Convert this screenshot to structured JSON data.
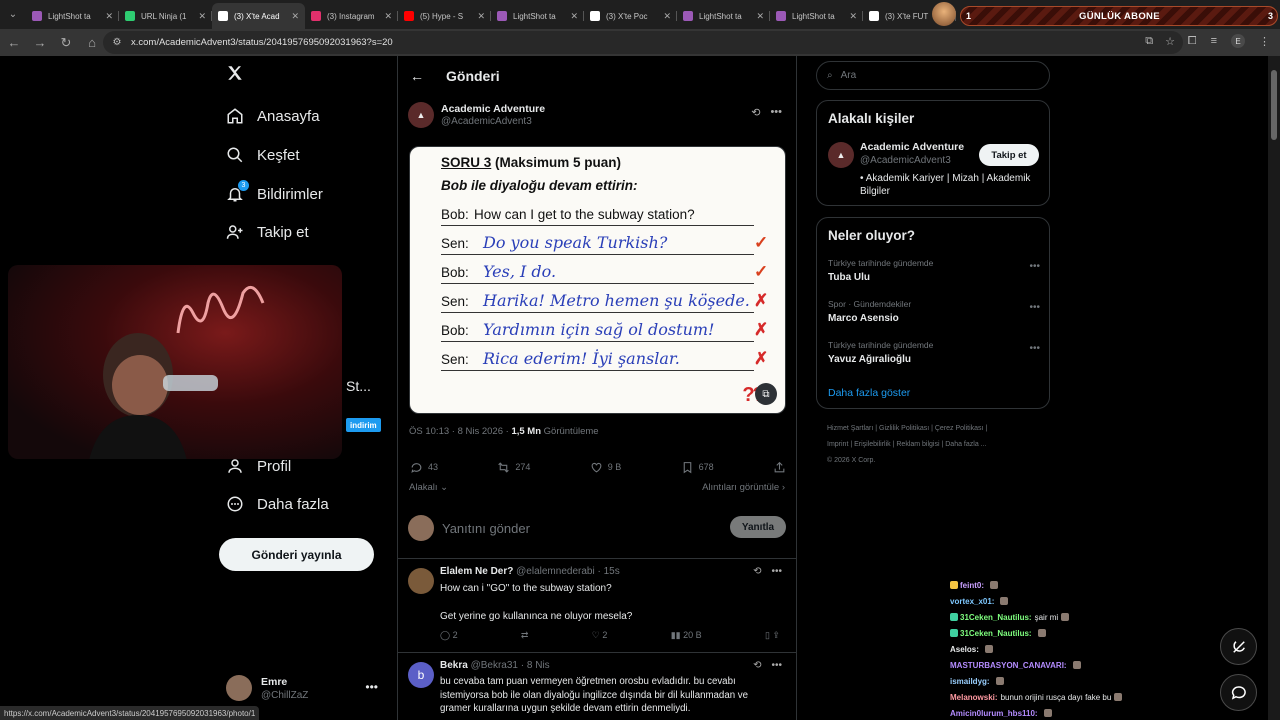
{
  "browser": {
    "tabs": [
      {
        "title": "LightShot ta",
        "color": "#9b59b6",
        "active": false
      },
      {
        "title": "URL Ninja (1",
        "color": "#2ecc71",
        "active": false
      },
      {
        "title": "(3) X'te Acad",
        "color": "#ffffff",
        "active": true
      },
      {
        "title": "(3) Instagram",
        "color": "#e1306c",
        "active": false
      },
      {
        "title": "(5) Hype - S",
        "color": "#ff0000",
        "active": false
      },
      {
        "title": "LightShot ta",
        "color": "#9b59b6",
        "active": false
      },
      {
        "title": "(3) X'te Poc",
        "color": "#ffffff",
        "active": false
      },
      {
        "title": "LightShot ta",
        "color": "#9b59b6",
        "active": false
      },
      {
        "title": "LightShot ta",
        "color": "#9b59b6",
        "active": false
      },
      {
        "title": "(3) X'te FUT",
        "color": "#ffffff",
        "active": false
      }
    ],
    "url": "x.com/AcademicAdvent3/status/2041957695092031963?s=20",
    "profile_initial": "E",
    "status_url": "https://x.com/AcademicAdvent3/status/2041957695092031963/photo/1"
  },
  "stream": {
    "banner_text": "GÜNLÜK ABONE",
    "level_left": "1",
    "level_right": "3",
    "side_label": "St...",
    "badge": "indirim"
  },
  "nav": {
    "items": [
      {
        "label": "Anasayfa"
      },
      {
        "label": "Keşfet"
      },
      {
        "label": "Bildirimler",
        "badge": "3"
      },
      {
        "label": "Takip et"
      },
      {
        "label": "Profil"
      },
      {
        "label": "Daha fazla"
      }
    ],
    "post_button": "Gönderi yayınla",
    "account_name": "Emre",
    "account_handle": "@ChillZaZ"
  },
  "header": {
    "title": "Gönderi"
  },
  "post": {
    "author_name": "Academic Adventure",
    "author_handle": "@AcademicAdvent3",
    "image": {
      "heading_underlined": "SORU 3",
      "heading_rest": " (Maksimum 5 puan)",
      "subheading": "Bob ile diyaloğu devam ettirin:",
      "lines": [
        {
          "speaker": "Bob:",
          "text": "How can I get to the subway station?",
          "handwritten": false,
          "mark": ""
        },
        {
          "speaker": "Sen:",
          "text": "Do you speak Turkish?",
          "handwritten": true,
          "mark": "✓"
        },
        {
          "speaker": "Bob:",
          "text": "Yes, I do.",
          "handwritten": true,
          "mark": "✓"
        },
        {
          "speaker": "Sen:",
          "text": "Harika! Metro hemen şu köşede.",
          "handwritten": true,
          "mark": "✗"
        },
        {
          "speaker": "Bob:",
          "text": "Yardımın için sağ ol dostum!",
          "handwritten": true,
          "mark": "✗"
        },
        {
          "speaker": "Sen:",
          "text": "Rica ederim! İyi şanslar.",
          "handwritten": true,
          "mark": "✗"
        }
      ],
      "corner_marks": "???"
    },
    "time": "ÖS 10:13 · 8 Nis 2026 · ",
    "views": "1,5 Mn",
    "views_label": " Görüntüleme",
    "replies": "43",
    "reposts": "274",
    "likes": "9 B",
    "bookmarks": "678",
    "related": "Alakalı",
    "quotes_link": "Alıntıları görüntüle ›",
    "reply_placeholder": "Yanıtını gönder",
    "reply_button": "Yanıtla"
  },
  "replies": [
    {
      "name": "Elalem Ne Der?",
      "handle": "@elalemnederabi · 15s",
      "lines": [
        "How can i \"GO\" to the subway station?",
        "",
        "Get yerine go kullanınca ne oluyor mesela?"
      ],
      "replies": "2",
      "reposts": "",
      "likes": "2",
      "views": "20 B",
      "avatar": "#7a5a3a"
    },
    {
      "name": "Bekra",
      "handle": "@Bekra31 · 8 Nis",
      "lines": [
        "bu cevaba tam puan vermeyen öğretmen orosbu evladıdır. bu cevabı",
        "istemiyorsa bob ile olan diyaloğu ingilizce dışında bir dil kullanmadan ve",
        "gramer kurallarına uygun şekilde devam ettirin denmeliydi."
      ],
      "avatar": "#5b5fc7",
      "initial": "b"
    }
  ],
  "right": {
    "search_placeholder": "Ara",
    "related_title": "Alakalı kişiler",
    "person_name": "Academic Adventure",
    "person_handle": "@AcademicAdvent3",
    "person_bio": "• Akademik Kariyer | Mizah | Akademik Bilgiler",
    "follow": "Takip et",
    "trends_title": "Neler oluyor?",
    "trends": [
      {
        "context": "Türkiye tarihinde gündemde",
        "name": "Tuba Ulu"
      },
      {
        "context": "Spor · Gündemdekiler",
        "name": "Marco Asensio"
      },
      {
        "context": "Türkiye tarihinde gündemde",
        "name": "Yavuz Ağıralioğlu"
      }
    ],
    "show_more": "Daha fazla göster",
    "footer_line1": "Hizmet Şartları  |  Gizlilik Politikası  |  Çerez Politikası  |",
    "footer_line2": "Imprint  |  Erişilebilirlik  |  Reklam bilgisi  |  Daha fazla ...",
    "footer_line3": "© 2026 X Corp."
  },
  "chat": [
    {
      "user": "feint0:",
      "msg": "",
      "color": "#c9a0ff",
      "icon": "#f4c542"
    },
    {
      "user": "vortex_x01:",
      "msg": "",
      "color": "#7ec8ff",
      "icon": ""
    },
    {
      "user": "31Ceken_Nautilus:",
      "msg": "şair mi",
      "color": "#7fff7f",
      "icon": "#3fd0a0"
    },
    {
      "user": "31Ceken_Nautilus:",
      "msg": "",
      "color": "#7fff7f",
      "icon": "#3fd0a0"
    },
    {
      "user": "Aselos:",
      "msg": "",
      "color": "#e7e9ea",
      "icon": ""
    },
    {
      "user": "MASTURBASYON_CANAVARI:",
      "msg": "",
      "color": "#b48cff",
      "icon": ""
    },
    {
      "user": "ismaildyg:",
      "msg": "",
      "color": "#9ad0ff",
      "icon": ""
    },
    {
      "user": "Melanowski:",
      "msg": "bunun orijini rusça dayı fake bu",
      "color": "#ff9aa2",
      "icon": ""
    },
    {
      "user": "Amicin0lurum_hbs110:",
      "msg": "",
      "color": "#b48cff",
      "icon": ""
    }
  ]
}
